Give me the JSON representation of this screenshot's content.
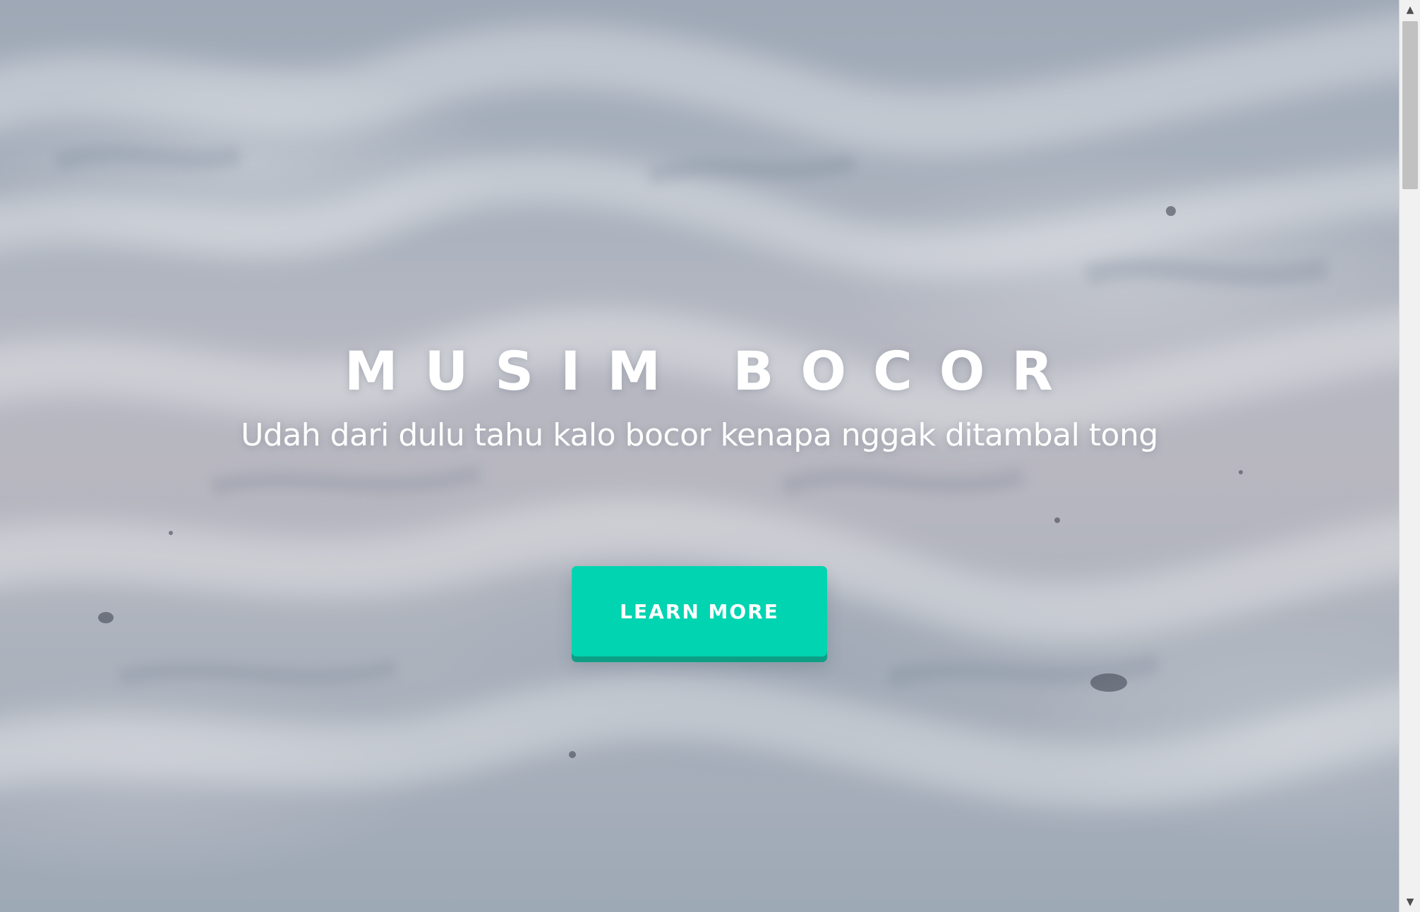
{
  "hero": {
    "title": "MUSIM BOCOR",
    "subtitle": "Udah dari dulu tahu kalo bocor kenapa nggak ditambal tong",
    "cta_label": "LEARN MORE",
    "background_image": "sand-dunes-background"
  },
  "scrollbar": {
    "up_icon": "▲",
    "down_icon": "▼",
    "thumb_position": 0.0
  },
  "colors": {
    "accent": "#00d4b0",
    "accent_shadow": "#0c9f85",
    "text": "#ffffff"
  }
}
